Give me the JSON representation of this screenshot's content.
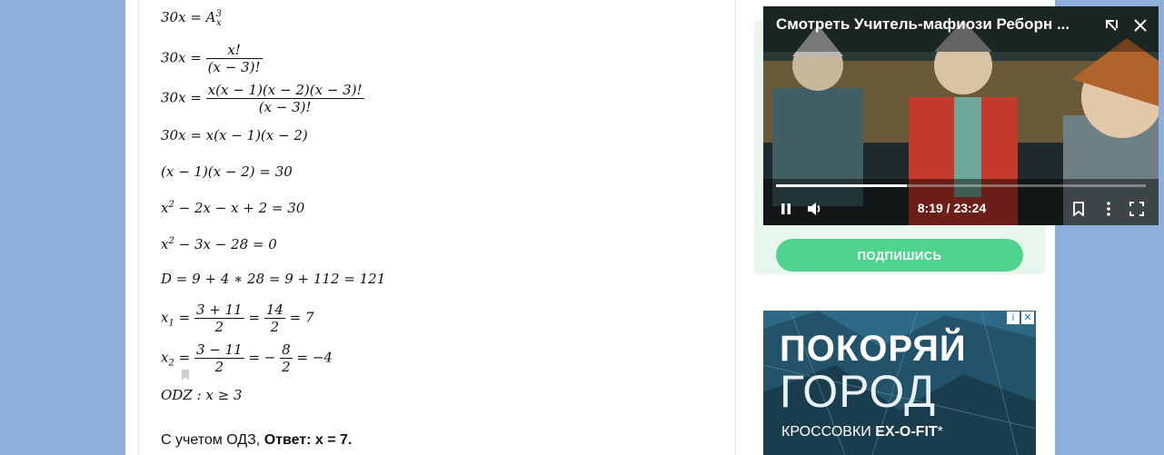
{
  "math": {
    "l1_lhs": "30x = ",
    "l1_A": "A",
    "l1_sup": "3",
    "l1_sub": "x",
    "l2_lhs": "30x = ",
    "l2_num": "x!",
    "l2_den": "(x − 3)!",
    "l3_lhs": "30x = ",
    "l3_num": "x(x − 1)(x − 2)(x − 3)!",
    "l3_den": "(x − 3)!",
    "l4": "30x = x(x − 1)(x − 2)",
    "l5": "(x − 1)(x − 2) = 30",
    "l6_a": "x",
    "l6_sup": "2",
    "l6_b": " − 2x − x + 2 = 30",
    "l7_a": "x",
    "l7_sup": "2",
    "l7_b": " − 3x − 28 = 0",
    "l8": "D = 9 + 4 ∗ 28 = 9 + 112 = 121",
    "l9_x": "x",
    "l9_sub": "1",
    "l9_eq": " = ",
    "l9_num1": "3 + 11",
    "l9_den1": "2",
    "l9_eq2": " = ",
    "l9_num2": "14",
    "l9_den2": "2",
    "l9_end": " = 7",
    "l10_x": "x",
    "l10_sub": "2",
    "l10_eq": " = ",
    "l10_num1": "3 − 11",
    "l10_den1": "2",
    "l10_eq2": " = −",
    "l10_num2": "8",
    "l10_den2": "2",
    "l10_end": " = −4",
    "l11": "ODZ :    x ≥ 3"
  },
  "answer": {
    "prefix": "С учетом ОДЗ, ",
    "bold": "Ответ: x = 7."
  },
  "sidebar": {
    "subscribe_label": "ПОДПИШИСЬ"
  },
  "video": {
    "title": "Смотреть Учитель-мафиози Реборн ...",
    "time": "8:19 / 23:24",
    "progress_fraction": 0.355
  },
  "ad": {
    "line1": "ПОКОРЯЙ",
    "line2": "ГОРОД",
    "line3_prefix": "КРОССОВКИ ",
    "line3_bold": "EX-O-FIT",
    "line3_suffix": "*"
  },
  "colors": {
    "page_bg": "#8eaedc",
    "subscribe_green": "#4fd38f",
    "card_bg": "#e8f7ee"
  }
}
